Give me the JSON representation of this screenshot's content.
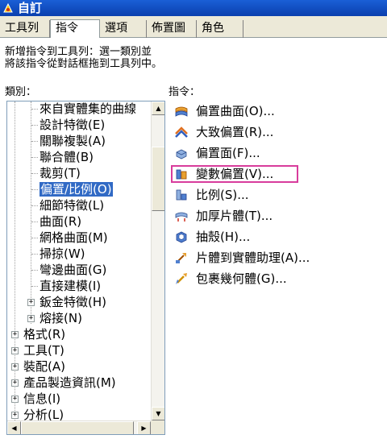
{
  "window": {
    "title": "自訂"
  },
  "tabs": [
    {
      "label": "工具列"
    },
    {
      "label": "指令"
    },
    {
      "label": "選項"
    },
    {
      "label": "佈置圖"
    },
    {
      "label": "角色"
    }
  ],
  "description": "新增指令到工具列：選一類別並\n將該指令從對話框拖到工具列中。",
  "categories_label": "類別：",
  "commands_label": "指令：",
  "categories": [
    {
      "label": "來自實體集的曲線"
    },
    {
      "label": "設計特徵(E)"
    },
    {
      "label": "關聯複製(A)"
    },
    {
      "label": "聯合體(B)"
    },
    {
      "label": "裁剪(T)"
    },
    {
      "label": "偏置/比例(O)"
    },
    {
      "label": "細節特徵(L)"
    },
    {
      "label": "曲面(R)"
    },
    {
      "label": "網格曲面(M)"
    },
    {
      "label": "掃掠(W)"
    },
    {
      "label": "彎邊曲面(G)"
    },
    {
      "label": "直接建模(I)"
    },
    {
      "label": "鈑金特徵(H)"
    },
    {
      "label": "熔接(N)"
    },
    {
      "label": "格式(R)"
    },
    {
      "label": "工具(T)"
    },
    {
      "label": "裝配(A)"
    },
    {
      "label": "產品製造資訊(M)"
    },
    {
      "label": "信息(I)"
    },
    {
      "label": "分析(L)"
    }
  ],
  "commands": [
    {
      "label": "偏置曲面(O)...",
      "icon": "offset-surface-icon"
    },
    {
      "label": "大致偏置(R)...",
      "icon": "rough-offset-icon"
    },
    {
      "label": "偏置面(F)...",
      "icon": "offset-face-icon"
    },
    {
      "label": "變數偏置(V)...",
      "icon": "variable-offset-icon"
    },
    {
      "label": "比例(S)...",
      "icon": "scale-icon"
    },
    {
      "label": "加厚片體(T)...",
      "icon": "thicken-sheet-icon"
    },
    {
      "label": "抽殼(H)...",
      "icon": "shell-icon"
    },
    {
      "label": "片體到實體助理(A)...",
      "icon": "sheets-to-solid-icon"
    },
    {
      "label": "包裹幾何體(G)...",
      "icon": "wrap-geometry-icon"
    }
  ],
  "colors": {
    "selection": "#316ac5",
    "highlight_box": "#d83c9c",
    "title_bar": "#1a5fd6"
  }
}
